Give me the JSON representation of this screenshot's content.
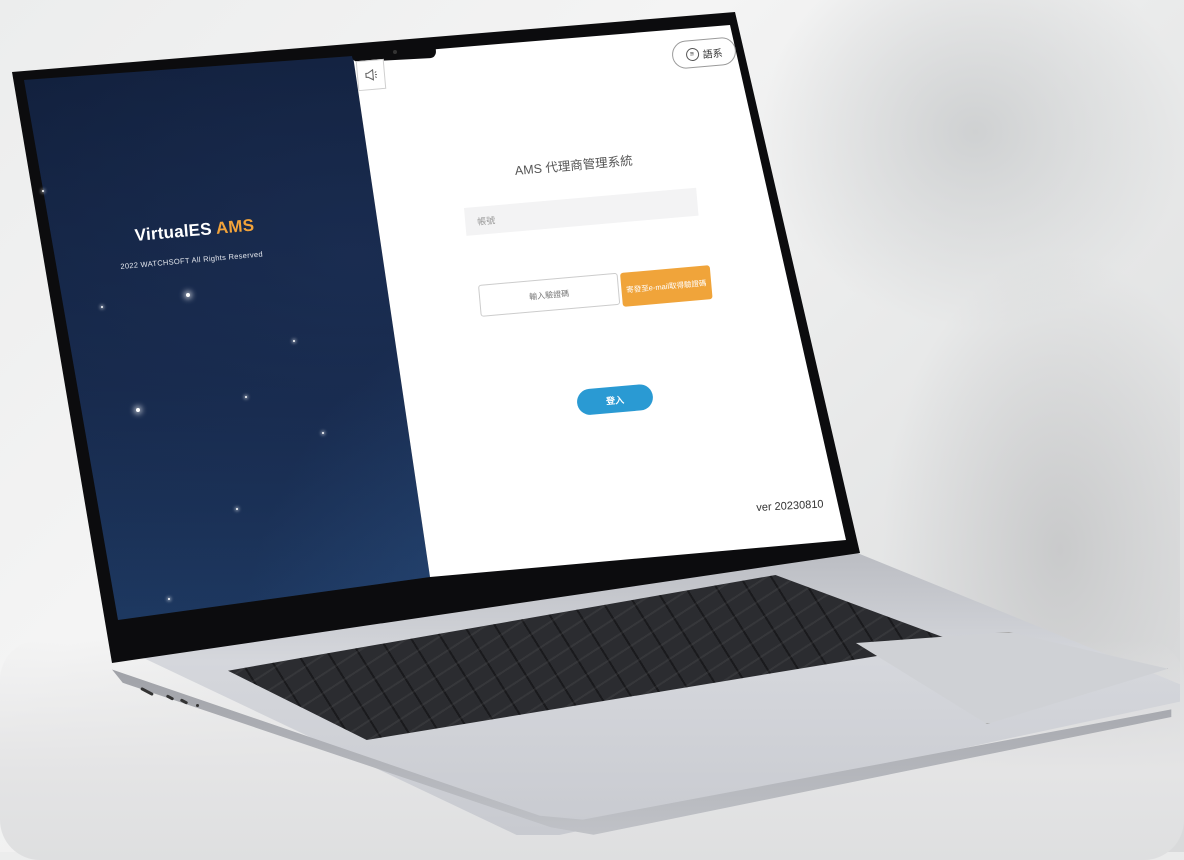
{
  "left_panel": {
    "brand_name": "VirtualES",
    "brand_accent": "AMS",
    "copyright": "2022 WATCHSOFT All Rights Reserved",
    "accent_color": "#f2a33a"
  },
  "header": {
    "announcement_icon": "megaphone-icon",
    "language_label": "語系",
    "language_icon": "language-icon"
  },
  "login_form": {
    "title": "AMS 代理商管理系統",
    "account_placeholder": "帳號",
    "verification_placeholder": "輸入驗證碼",
    "send_code_label": "寄發至e-mail取得驗證碼",
    "login_label": "登入",
    "login_color": "#2a9ad3",
    "send_code_color": "#f0a43a"
  },
  "footer": {
    "version": "ver 20230810"
  }
}
